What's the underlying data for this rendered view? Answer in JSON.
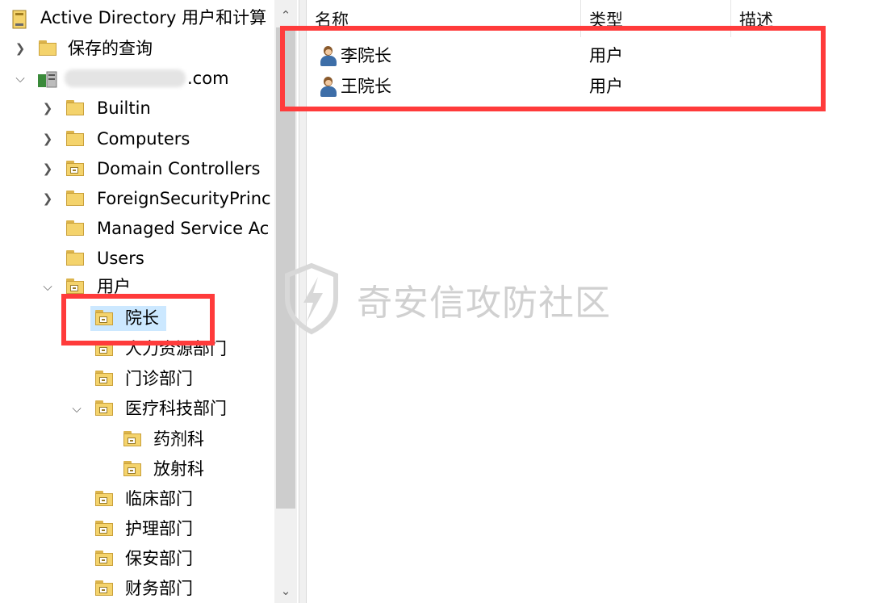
{
  "tree": {
    "root_label": "Active Directory 用户和计算",
    "items": [
      {
        "label": "保存的查询"
      },
      {
        "label": ".com"
      },
      {
        "label": "Builtin"
      },
      {
        "label": "Computers"
      },
      {
        "label": "Domain Controllers"
      },
      {
        "label": "ForeignSecurityPrinc"
      },
      {
        "label": "Managed Service Ac"
      },
      {
        "label": "Users"
      },
      {
        "label": "用户"
      },
      {
        "label": "院长"
      },
      {
        "label": "人力资源部门"
      },
      {
        "label": "门诊部门"
      },
      {
        "label": "医疗科技部门"
      },
      {
        "label": "药剂科"
      },
      {
        "label": "放射科"
      },
      {
        "label": "临床部门"
      },
      {
        "label": "护理部门"
      },
      {
        "label": "保安部门"
      },
      {
        "label": "财务部门"
      }
    ]
  },
  "list": {
    "columns": [
      "名称",
      "类型",
      "描述"
    ],
    "rows": [
      {
        "name": "李院长",
        "type": "用户",
        "description": ""
      },
      {
        "name": "王院长",
        "type": "用户",
        "description": ""
      }
    ]
  },
  "watermark": {
    "text": "奇安信攻防社区"
  },
  "colors": {
    "highlight_box": "#ff3b3b",
    "selection": "#cce8ff",
    "folder": "#f4d36c"
  }
}
